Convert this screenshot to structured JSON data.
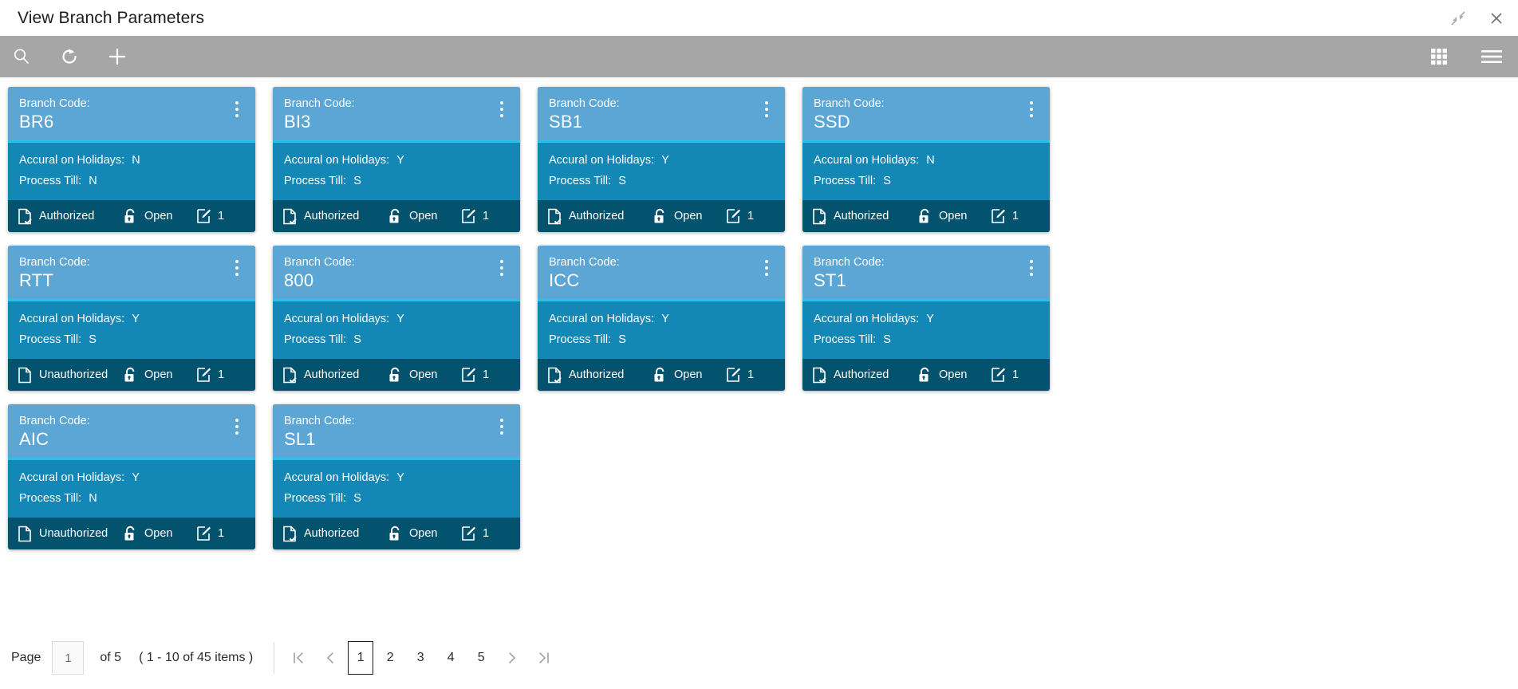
{
  "window": {
    "title": "View Branch Parameters",
    "restore_icon": "collapse-arrows-icon",
    "close_icon": "close-icon"
  },
  "toolbar": {
    "search_icon": "search-icon",
    "refresh_icon": "refresh-icon",
    "add_icon": "plus-icon",
    "grid_view_icon": "grid-view-icon",
    "list_view_icon": "hamburger-menu-icon"
  },
  "card_labels": {
    "branch_code": "Branch Code:",
    "accural": "Accural on Holidays:",
    "process_till": "Process Till:",
    "kebab_icon": "kebab-menu-icon",
    "lock_icon": "unlock-icon",
    "edit_icon": "edit-icon",
    "authorized_icon": "document-check-icon",
    "unauthorized_icon": "document-icon"
  },
  "colors": {
    "card_header": "#5ba6d4",
    "card_divider": "#29c0ec",
    "card_body": "#1387b5",
    "card_footer": "#03536f",
    "toolbar": "#a6a6a6"
  },
  "cards": [
    {
      "branch_code": "BR6",
      "accural": "N",
      "process_till": "N",
      "status": "Authorized",
      "lock": "Open",
      "mod_no": "1"
    },
    {
      "branch_code": "BI3",
      "accural": "Y",
      "process_till": "S",
      "status": "Authorized",
      "lock": "Open",
      "mod_no": "1"
    },
    {
      "branch_code": "SB1",
      "accural": "Y",
      "process_till": "S",
      "status": "Authorized",
      "lock": "Open",
      "mod_no": "1"
    },
    {
      "branch_code": "SSD",
      "accural": "N",
      "process_till": "S",
      "status": "Authorized",
      "lock": "Open",
      "mod_no": "1"
    },
    {
      "branch_code": "RTT",
      "accural": "Y",
      "process_till": "S",
      "status": "Unauthorized",
      "lock": "Open",
      "mod_no": "1"
    },
    {
      "branch_code": "800",
      "accural": "Y",
      "process_till": "S",
      "status": "Authorized",
      "lock": "Open",
      "mod_no": "1"
    },
    {
      "branch_code": "ICC",
      "accural": "Y",
      "process_till": "S",
      "status": "Authorized",
      "lock": "Open",
      "mod_no": "1"
    },
    {
      "branch_code": "ST1",
      "accural": "Y",
      "process_till": "S",
      "status": "Authorized",
      "lock": "Open",
      "mod_no": "1"
    },
    {
      "branch_code": "AIC",
      "accural": "Y",
      "process_till": "N",
      "status": "Unauthorized",
      "lock": "Open",
      "mod_no": "1"
    },
    {
      "branch_code": "SL1",
      "accural": "Y",
      "process_till": "S",
      "status": "Authorized",
      "lock": "Open",
      "mod_no": "1"
    }
  ],
  "pagination": {
    "page_label": "Page",
    "page_value": "1",
    "of_label": "of 5",
    "items_label": "( 1 - 10 of 45 items )",
    "first_icon": "first-page-icon",
    "prev_icon": "prev-page-icon",
    "next_icon": "next-page-icon",
    "last_icon": "last-page-icon",
    "pages": [
      "1",
      "2",
      "3",
      "4",
      "5"
    ],
    "active_page": "1"
  }
}
